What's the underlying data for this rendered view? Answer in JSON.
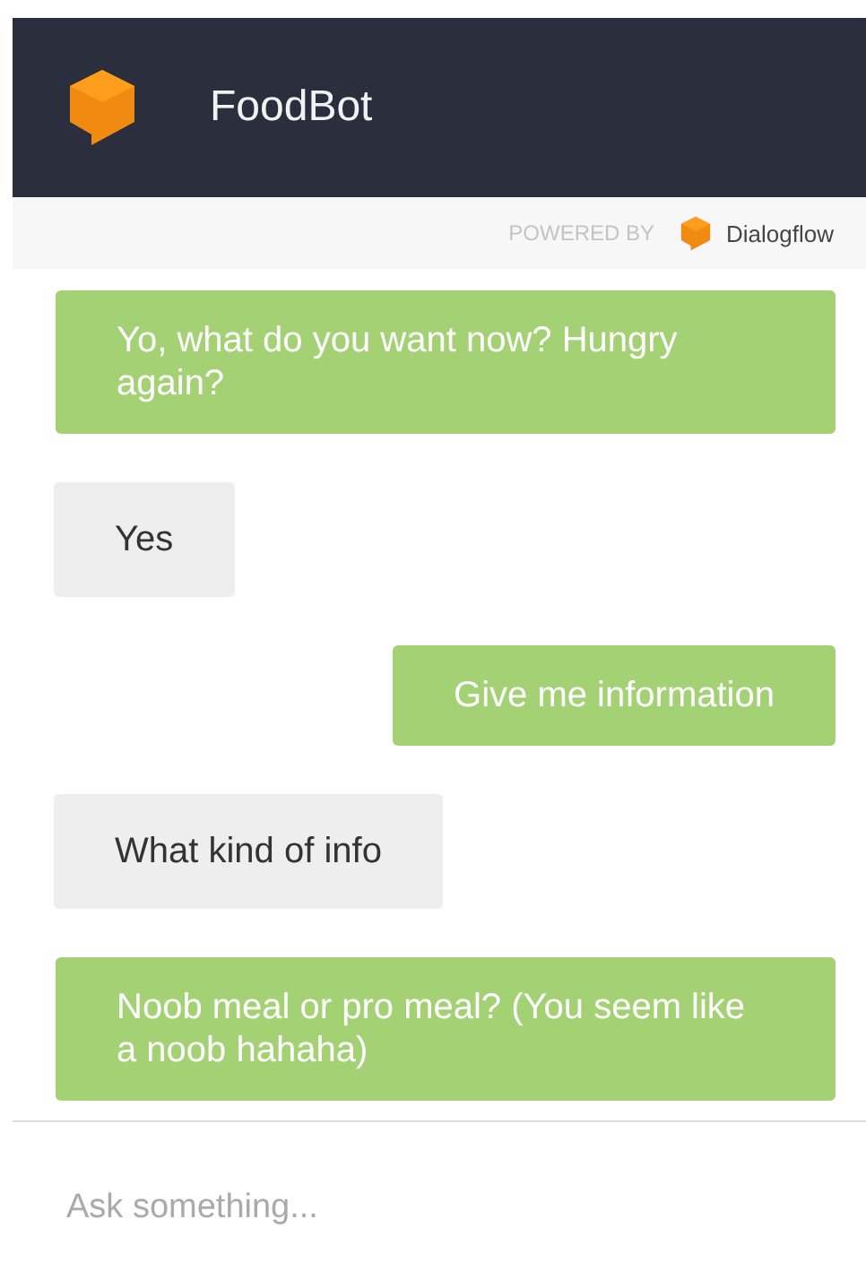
{
  "header": {
    "title": "FoodBot"
  },
  "powered_by": {
    "label": "POWERED BY",
    "brand": "Dialogflow"
  },
  "messages": [
    {
      "kind": "bot",
      "text": "Yo, what do you want now? Hungry again?"
    },
    {
      "kind": "user",
      "text": "Yes"
    },
    {
      "kind": "bot",
      "text": "Give me information"
    },
    {
      "kind": "user",
      "text": "What kind of info"
    },
    {
      "kind": "bot",
      "text": "Noob meal or pro meal? (You seem like a noob hahaha)"
    }
  ],
  "input": {
    "placeholder": "Ask something..."
  }
}
